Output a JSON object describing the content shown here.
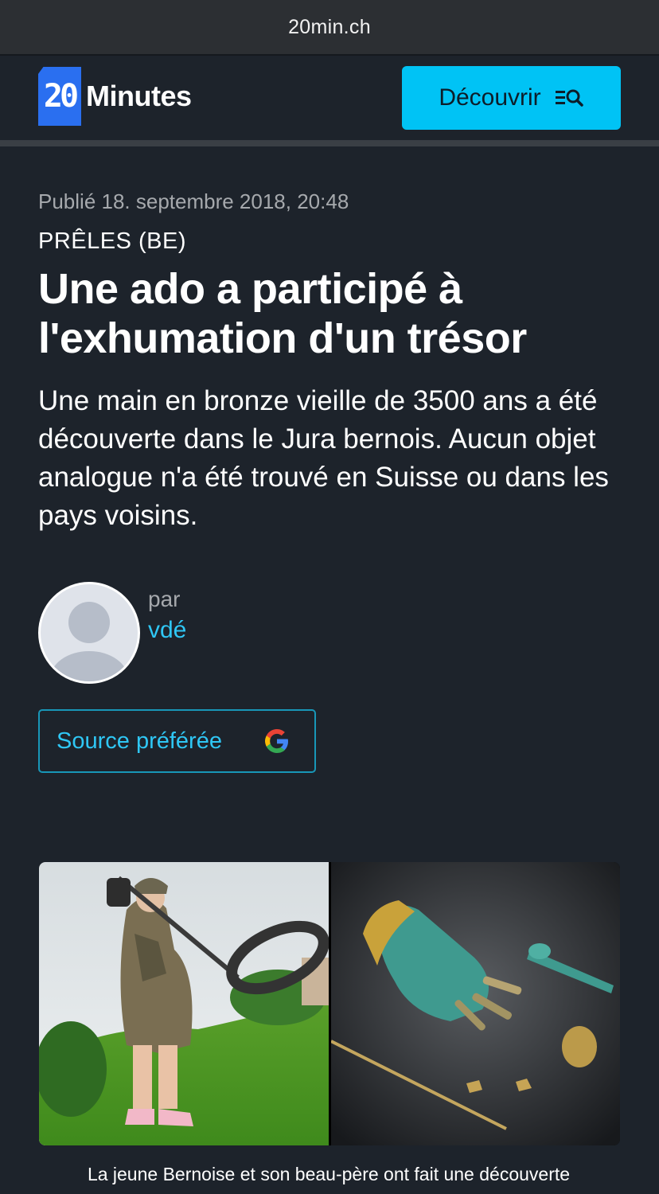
{
  "browser": {
    "url": "20min.ch"
  },
  "header": {
    "logo_number": "20",
    "logo_text": "Minutes",
    "discover_label": "Découvrir"
  },
  "article": {
    "published": "Publié 18. septembre 2018, 20:48",
    "kicker": "PRÊLES (BE)",
    "headline": "Une ado a participé à l'exhumation d'un trésor",
    "lead": "Une main en bronze vieille de 3500 ans a été découverte dans le Jura bernois. Aucun objet analogue n'a été trouvé en Suisse ou dans les pays voisins.",
    "by_label": "par",
    "author": "vdé",
    "source_button": "Source préférée",
    "caption": "La jeune Bernoise et son beau-père ont fait une découverte"
  },
  "colors": {
    "background": "#1d232b",
    "accent": "#00c3f5",
    "link": "#2fc7f5",
    "logo_blue": "#2a6ff0"
  },
  "icons": {
    "discover": "search-list-icon",
    "source": "google-g-icon",
    "avatar": "user-placeholder-icon"
  }
}
